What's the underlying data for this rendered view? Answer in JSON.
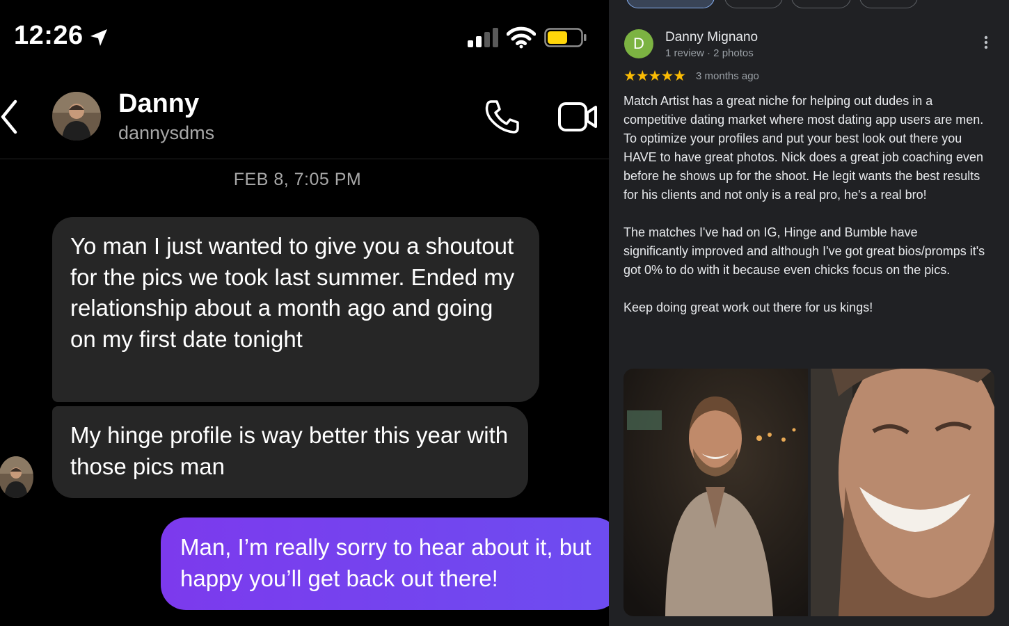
{
  "status_bar": {
    "time": "12:26"
  },
  "chat_header": {
    "name": "Danny",
    "handle": "dannysdms"
  },
  "conversation": {
    "timestamp": "FEB 8, 7:05 PM",
    "messages": [
      {
        "sender": "them",
        "text": "Yo man I just wanted to give you a shoutout for the pics we took last summer. Ended my relationship about a month ago and going on my first date tonight"
      },
      {
        "sender": "them",
        "text": "My hinge profile is way better this year with those pics man"
      },
      {
        "sender": "me",
        "text": "Man, I’m really sorry to hear about it, but happy you’ll get back out there!"
      }
    ]
  },
  "review": {
    "avatar_letter": "D",
    "avatar_color": "#7cb342",
    "reviewer_name": "Danny Mignano",
    "reviewer_meta": "1 review · 2 photos",
    "stars": "★★★★★",
    "time_ago": "3 months ago",
    "paragraphs": [
      "Match Artist has a great niche for helping out dudes in a competitive dating market where most dating app users are men. To optimize your profiles and put your best look out there you HAVE to have great photos. Nick does a great job coaching even before he shows up for the shoot. He legit wants the best results for his clients and not only is a real pro, he's a real bro!",
      "The matches I've had on IG, Hinge and Bumble have significantly improved and although I've got great bios/promps it's got 0% to do with it because even chicks focus on the pics.",
      "Keep doing great work out there for us kings!"
    ]
  },
  "colors": {
    "outgoing_bubble": "#7c3aed",
    "incoming_bubble": "#262626",
    "star": "#fbbc04",
    "battery": "#ffd60a"
  }
}
